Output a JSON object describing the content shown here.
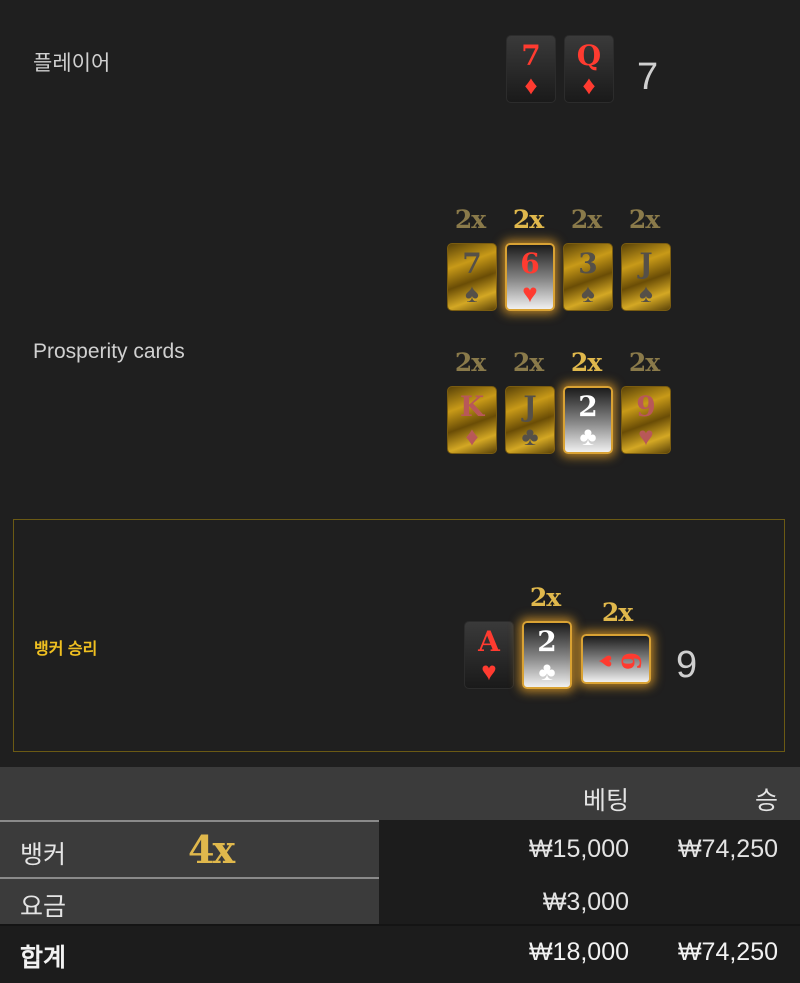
{
  "player": {
    "label": "플레이어",
    "cards": [
      {
        "rank": "7",
        "suit": "♦"
      },
      {
        "rank": "Q",
        "suit": "♦"
      }
    ],
    "score": "7"
  },
  "prosperity": {
    "label": "Prosperity cards",
    "row1": [
      {
        "mult": "2x",
        "rank": "7",
        "suit": "♠",
        "highlight": false
      },
      {
        "mult": "2x",
        "rank": "6",
        "suit": "♥",
        "highlight": true
      },
      {
        "mult": "2x",
        "rank": "3",
        "suit": "♠",
        "highlight": false
      },
      {
        "mult": "2x",
        "rank": "J",
        "suit": "♠",
        "highlight": false
      }
    ],
    "row2": [
      {
        "mult": "2x",
        "rank": "K",
        "suit": "♦",
        "highlight": false
      },
      {
        "mult": "2x",
        "rank": "J",
        "suit": "♣",
        "highlight": false
      },
      {
        "mult": "2x",
        "rank": "2",
        "suit": "♣",
        "highlight": true
      },
      {
        "mult": "2x",
        "rank": "9",
        "suit": "♥",
        "highlight": false
      }
    ]
  },
  "banker": {
    "label": "뱅커 승리",
    "cards": [
      {
        "rank": "A",
        "suit": "♥",
        "mult": ""
      },
      {
        "rank": "2",
        "suit": "♣",
        "mult": "2x"
      },
      {
        "rank": "6",
        "suit": "♥",
        "mult": "2x"
      }
    ],
    "score": "9"
  },
  "table": {
    "header": {
      "bet": "베팅",
      "win": "승"
    },
    "rows": [
      {
        "name": "뱅커",
        "multiplier": "4x",
        "bet": "₩15,000",
        "win": "₩74,250"
      },
      {
        "name": "요금",
        "multiplier": "",
        "bet": "₩3,000",
        "win": ""
      }
    ],
    "total": {
      "name": "합계",
      "bet": "₩18,000",
      "win": "₩74,250"
    }
  },
  "colors": {
    "accent_gold": "#e0b84c",
    "winner_label": "#f0c020",
    "card_red": "#ff3b30"
  }
}
